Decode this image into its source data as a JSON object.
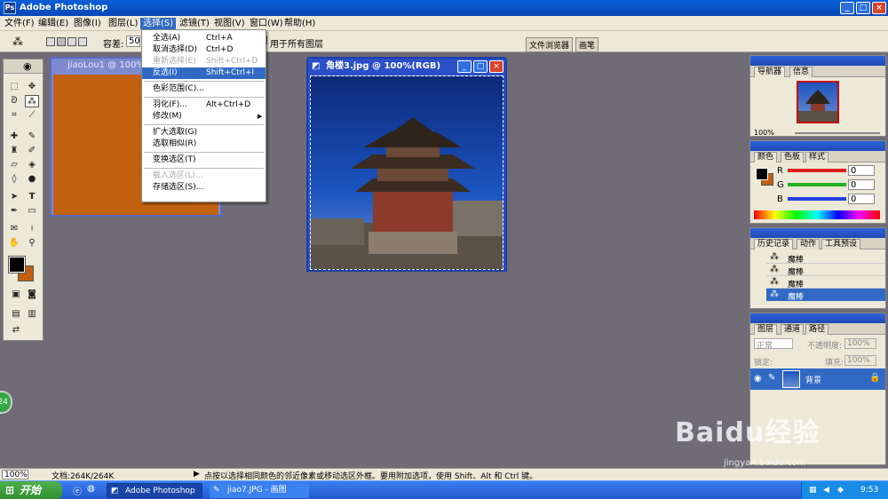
{
  "window": {
    "title": "Adobe Photoshop",
    "controls": [
      "_",
      "□",
      "×"
    ]
  },
  "menubar": [
    "文件(F)",
    "编辑(E)",
    "图像(I)",
    "图层(L)",
    "选择(S)",
    "滤镜(T)",
    "视图(V)",
    "窗口(W)",
    "帮助(H)"
  ],
  "options": {
    "tolerance_label": "容差:",
    "tolerance_value": "50",
    "all_layers_label": "用于所有图层",
    "tabs": [
      "文件浏览器",
      "画笔"
    ]
  },
  "select_menu": [
    {
      "label": "全选(A)",
      "shortcut": "Ctrl+A",
      "state": "normal"
    },
    {
      "label": "取消选择(D)",
      "shortcut": "Ctrl+D",
      "state": "normal"
    },
    {
      "label": "重新选择(E)",
      "shortcut": "Shift+Ctrl+D",
      "state": "disabled"
    },
    {
      "label": "反选(I)",
      "shortcut": "Shift+Ctrl+I",
      "state": "highlighted"
    },
    {
      "sep": true
    },
    {
      "label": "色彩范围(C)...",
      "shortcut": "",
      "state": "normal"
    },
    {
      "sep": true
    },
    {
      "label": "羽化(F)...",
      "shortcut": "Alt+Ctrl+D",
      "state": "normal"
    },
    {
      "label": "修改(M)",
      "shortcut": "",
      "state": "normal",
      "submenu": true
    },
    {
      "sep": true
    },
    {
      "label": "扩大选取(G)",
      "shortcut": "",
      "state": "normal"
    },
    {
      "label": "选取相似(R)",
      "shortcut": "",
      "state": "normal"
    },
    {
      "sep": true
    },
    {
      "label": "变换选区(T)",
      "shortcut": "",
      "state": "normal"
    },
    {
      "sep": true
    },
    {
      "label": "载入选区(L)...",
      "shortcut": "",
      "state": "disabled"
    },
    {
      "label": "存储选区(S)...",
      "shortcut": "",
      "state": "normal"
    }
  ],
  "doc1": {
    "title": "jiaoLou1 @ 100%"
  },
  "doc2": {
    "title": "角楼3.jpg @ 100%(RGB)"
  },
  "navigator": {
    "tabs": [
      "导航器",
      "信息"
    ],
    "zoom": "100%"
  },
  "color": {
    "tabs": [
      "颜色",
      "色板",
      "样式"
    ],
    "channels": [
      {
        "name": "R",
        "value": "0",
        "color": "#e02020"
      },
      {
        "name": "G",
        "value": "0",
        "color": "#20b020"
      },
      {
        "name": "B",
        "value": "0",
        "color": "#2040e0"
      }
    ]
  },
  "history": {
    "tabs": [
      "历史记录",
      "动作",
      "工具预设"
    ],
    "items": [
      "魔棒",
      "魔棒",
      "魔棒",
      "魔棒"
    ]
  },
  "layers": {
    "tabs": [
      "图层",
      "通道",
      "路径"
    ],
    "mode": "正常",
    "opacity_label": "不透明度:",
    "opacity": "100%",
    "lock_label": "锁定:",
    "fill_label": "填充:",
    "fill": "100%",
    "layer_name": "背景"
  },
  "status": {
    "zoom": "100%",
    "doc": "文档:264K/264K",
    "hint": "点按以选择相同颜色的邻近像素或移动选区外框。要用附加选项，使用 Shift、Alt 和 Ctrl 键。"
  },
  "taskbar": {
    "start": "开始",
    "tasks": [
      "Adobe Photoshop",
      "jiao7.JPG - 画图"
    ],
    "time": "9:53"
  },
  "badge": "24",
  "watermark": {
    "brand": "Baidu经验",
    "url": "jingyan.baidu.com"
  },
  "colors": {
    "accent": "#316ac5",
    "doc1_fill": "#c2600f",
    "foreground": "#000000",
    "background": "#c2600f"
  }
}
